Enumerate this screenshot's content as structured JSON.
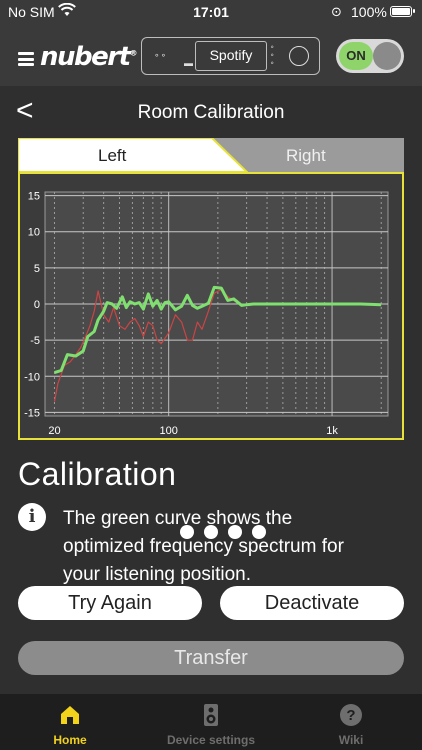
{
  "status_bar": {
    "carrier": "No SIM",
    "time": "17:01",
    "battery": "100%"
  },
  "header": {
    "logo": "nubert",
    "source_label": "Spotify",
    "power_label": "ON"
  },
  "page": {
    "title": "Room Calibration",
    "back_label": "<"
  },
  "tabs": [
    {
      "label": "Left",
      "active": true
    },
    {
      "label": "Right",
      "active": false
    }
  ],
  "chart_data": {
    "type": "line",
    "x_scale": "log",
    "xlim": [
      17.5,
      2200
    ],
    "ylim": [
      -15.5,
      15.5
    ],
    "y_ticks": [
      15,
      10,
      5,
      0,
      -5,
      -10,
      -15
    ],
    "x_ticks": [
      {
        "value": 20,
        "label": "20"
      },
      {
        "value": 100,
        "label": "100"
      },
      {
        "value": 1000,
        "label": "1k"
      }
    ],
    "grid": true,
    "series": [
      {
        "color": "#7fe070",
        "x": [
          20,
          22,
          24,
          27,
          30,
          32,
          35,
          37,
          40,
          42,
          45,
          48,
          52,
          55,
          58,
          62,
          66,
          70,
          75,
          80,
          85,
          90,
          95,
          100,
          110,
          120,
          130,
          140,
          150,
          160,
          175,
          190,
          210,
          230,
          250,
          280,
          300,
          330,
          360,
          400,
          500,
          700,
          1000,
          1500,
          2000
        ],
        "y": [
          -9.5,
          -9.2,
          -7.0,
          -7.2,
          -6.5,
          -4.5,
          -3.8,
          -2.2,
          -1.0,
          0.2,
          0.0,
          -0.6,
          1.0,
          -0.5,
          0.3,
          0.0,
          0.2,
          -0.7,
          1.4,
          -0.3,
          0.5,
          -0.7,
          0.2,
          0.3,
          -0.8,
          -0.3,
          1.2,
          -0.2,
          -0.6,
          -0.3,
          0.1,
          2.3,
          2.2,
          0.5,
          0.7,
          -0.2,
          -0.1,
          0.0,
          0.0,
          0.0,
          0.0,
          0.0,
          0.0,
          0.0,
          -0.1
        ]
      },
      {
        "color": "#cc4444",
        "x": [
          20,
          21,
          23,
          25,
          27,
          29,
          31,
          33,
          35,
          37,
          40,
          43,
          46,
          50,
          54,
          58,
          62,
          66,
          70,
          75,
          80,
          85,
          90,
          100,
          110,
          120,
          130,
          140,
          150,
          160,
          175,
          190,
          210,
          230,
          250,
          280
        ],
        "y": [
          -13.5,
          -11.0,
          -8.5,
          -8.0,
          -7.0,
          -6.0,
          -4.5,
          -3.0,
          -1.0,
          1.8,
          -1.5,
          -2.5,
          -0.5,
          -3.0,
          -3.5,
          -2.5,
          -2.0,
          -3.0,
          -4.5,
          -2.5,
          -3.0,
          -5.0,
          -5.5,
          -4.0,
          -1.5,
          -2.5,
          -5.0,
          -5.0,
          -2.5,
          -3.5,
          -1.0,
          1.5,
          2.0,
          1.0,
          0.5,
          0.0
        ]
      }
    ]
  },
  "calibration": {
    "heading": "Calibration",
    "info_symbol": "i",
    "line1": "The green curve shows the",
    "line2": "optimized  frequency spectrum for",
    "line3": "your listening position."
  },
  "buttons": {
    "try_again": "Try Again",
    "deactivate": "Deactivate",
    "transfer": "Transfer"
  },
  "tab_bar": [
    {
      "label": "Home",
      "icon": "home-icon",
      "active": true,
      "color": "#f2d21b"
    },
    {
      "label": "Device settings",
      "icon": "speaker-icon",
      "active": false,
      "color": "#6e6e6e"
    },
    {
      "label": "Wiki",
      "icon": "help-icon",
      "active": false,
      "color": "#6e6e6e"
    }
  ],
  "colors": {
    "accent_yellow": "#e6e23a",
    "toggle_green": "#8ed46a",
    "tab_active": "#f2d21b"
  }
}
